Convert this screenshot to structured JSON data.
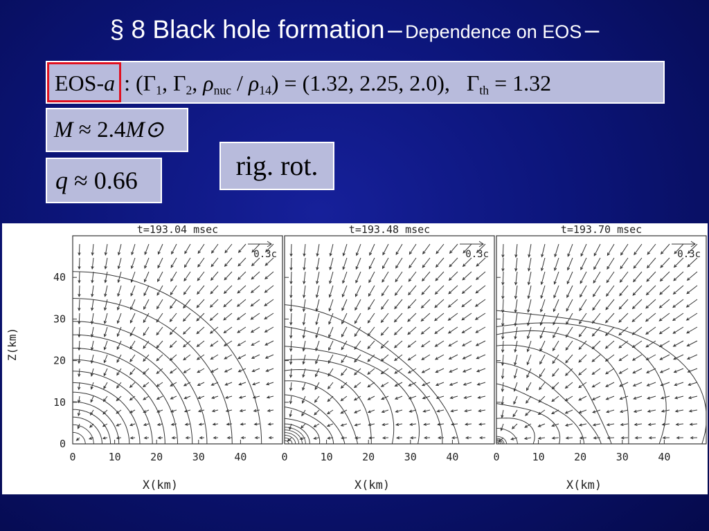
{
  "title": {
    "main": "§ 8  Black hole formation",
    "dash1": "–",
    "sub": "Dependence on EOS",
    "dash2": "–"
  },
  "eos": {
    "label": "EOS-a",
    "params_text": ": (Γ1, Γ2, ρnuc / ρ14) = (1.32, 2.25, 2.0),   Γth = 1.32",
    "gamma1": "1.32",
    "gamma2": "2.25",
    "rho_ratio": "2.0",
    "gamma_th": "1.32"
  },
  "mass": {
    "symbol": "M",
    "approx": "≈",
    "value": "2.4",
    "unit": "M⊙"
  },
  "q": {
    "symbol": "q",
    "approx": "≈",
    "value": "0.66"
  },
  "rotation_label": "rig. rot.",
  "panels": [
    {
      "time_label": "t=193.04 msec",
      "velocity_scale": "0.3c",
      "xlabel": "X(km)"
    },
    {
      "time_label": "t=193.48 msec",
      "velocity_scale": "0.3c",
      "xlabel": "X(km)"
    },
    {
      "time_label": "t=193.70 msec",
      "velocity_scale": "0.3c",
      "xlabel": "X(km)"
    }
  ],
  "ylabel": "Z(km)",
  "x_ticks": [
    "0",
    "10",
    "20",
    "30",
    "40"
  ],
  "y_ticks": [
    "0",
    "10",
    "20",
    "30",
    "40"
  ],
  "axis_range": {
    "x": [
      0,
      50
    ],
    "z": [
      0,
      50
    ]
  },
  "contour_radii_km": [
    [
      3,
      5,
      7,
      9,
      11,
      13.5,
      16,
      19,
      22,
      25,
      28.5,
      32,
      38,
      45
    ],
    [
      1,
      1.8,
      2.6,
      3.4,
      4.2,
      5,
      6,
      8,
      11,
      14,
      18,
      22,
      26.5,
      31,
      35.5,
      40
    ],
    [
      0.6,
      1,
      1.4,
      1.8,
      2.4,
      5,
      9,
      14,
      19,
      24,
      29,
      35,
      41,
      47
    ]
  ],
  "colors": {
    "background": "#0c157a",
    "box_fill": "#b8bbdc",
    "highlight_border": "#e01020"
  }
}
